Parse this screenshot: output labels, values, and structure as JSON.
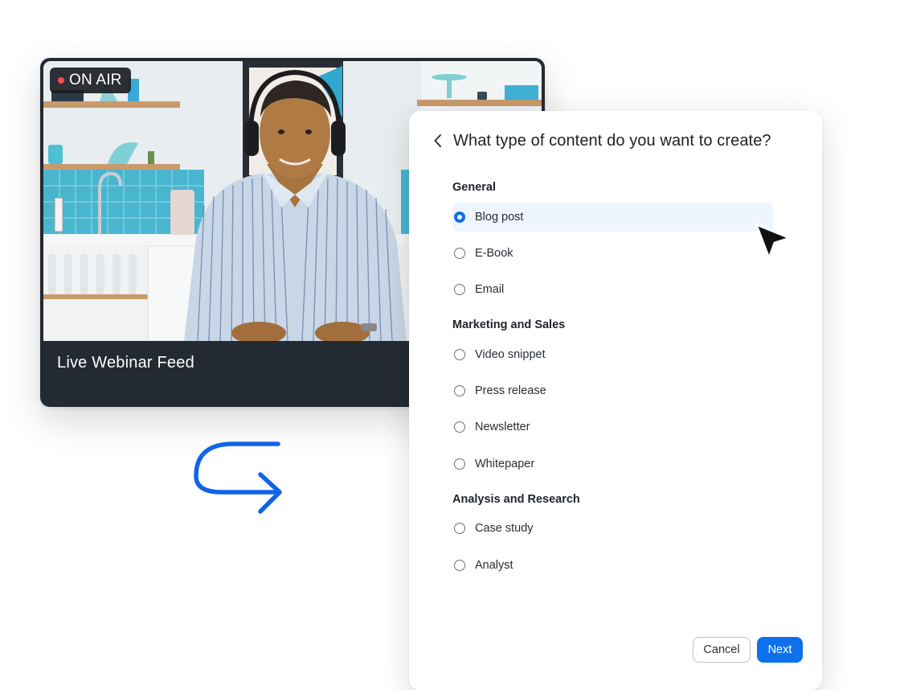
{
  "video": {
    "badge": "ON AIR",
    "caption": "Live Webinar Feed"
  },
  "dialog": {
    "title": "What type of content do you want to create?",
    "sections": [
      {
        "title": "General",
        "options": [
          {
            "label": "Blog post",
            "selected": true
          },
          {
            "label": "E-Book",
            "selected": false
          },
          {
            "label": "Email",
            "selected": false
          }
        ]
      },
      {
        "title": "Marketing and Sales",
        "options": [
          {
            "label": "Video snippet",
            "selected": false
          },
          {
            "label": "Press release",
            "selected": false
          },
          {
            "label": "Newsletter",
            "selected": false
          },
          {
            "label": "Whitepaper",
            "selected": false
          }
        ]
      },
      {
        "title": "Analysis and Research",
        "options": [
          {
            "label": "Case study",
            "selected": false
          },
          {
            "label": "Analyst",
            "selected": false
          }
        ]
      }
    ],
    "cancel_label": "Cancel",
    "next_label": "Next"
  },
  "colors": {
    "accent": "#0e71eb",
    "video_card_bg": "#242a33",
    "on_air_dot": "#ff4a4a",
    "selected_row_bg": "#eef5fe"
  },
  "icons": {
    "back": "chevron-left-icon",
    "live_indicator": "record-dot-icon",
    "flow_arrow": "return-arrow-icon",
    "pointer": "mouse-cursor-icon"
  }
}
